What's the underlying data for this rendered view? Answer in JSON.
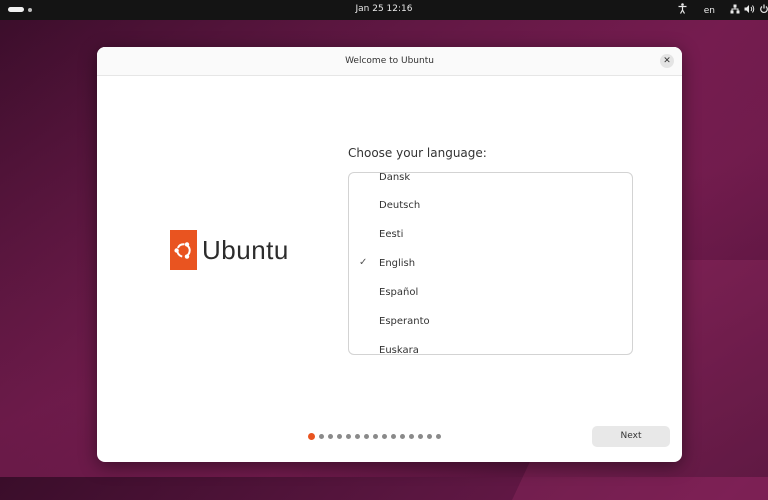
{
  "topbar": {
    "clock": "Jan 25  12:16",
    "keyboard_layout": "en",
    "icons": [
      "accessibility-icon",
      "network-icon",
      "volume-icon",
      "power-icon"
    ]
  },
  "window": {
    "title": "Welcome to Ubuntu",
    "logo_text": "Ubuntu",
    "prompt": "Choose your language:",
    "languages": [
      {
        "label": "Dansk",
        "selected": false
      },
      {
        "label": "Deutsch",
        "selected": false
      },
      {
        "label": "Eesti",
        "selected": false
      },
      {
        "label": "English",
        "selected": true
      },
      {
        "label": "Español",
        "selected": false
      },
      {
        "label": "Esperanto",
        "selected": false
      },
      {
        "label": "Euskara",
        "selected": false
      }
    ],
    "checkmark": "✓",
    "pager": {
      "total_pages": 15,
      "current_page": 1
    },
    "next_label": "Next"
  },
  "colors": {
    "accent": "#e95420",
    "topbar": "#141414"
  }
}
